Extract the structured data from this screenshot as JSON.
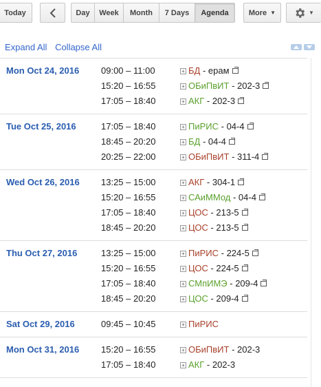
{
  "toolbar": {
    "today_label": "Today",
    "prev_icon": "chevron-left-icon",
    "views": [
      {
        "label": "Day",
        "active": false
      },
      {
        "label": "Week",
        "active": false
      },
      {
        "label": "Month",
        "active": false
      },
      {
        "label": "7 Days",
        "active": false
      },
      {
        "label": "Agenda",
        "active": true
      }
    ],
    "more_label": "More",
    "settings_icon": "gear-icon"
  },
  "controls": {
    "expand_all": "Expand All",
    "collapse_all": "Collapse All"
  },
  "colors": {
    "link": "#3366cc",
    "date": "#2a5db0",
    "red_event": "#a8402a",
    "green_event": "#5aa02c"
  },
  "agenda": [
    {
      "date": "Mon Oct 24, 2016",
      "events": [
        {
          "time": "09:00 – 11:00",
          "name": "БД",
          "rest": " - ерам",
          "color": "#a8402a"
        },
        {
          "time": "15:20 – 16:55",
          "name": "ОБиПвИТ",
          "rest": " - 202-3",
          "color": "#5aa02c"
        },
        {
          "time": "17:05 – 18:40",
          "name": "АКГ",
          "rest": " - 202-3",
          "color": "#5aa02c"
        }
      ]
    },
    {
      "date": "Tue Oct 25, 2016",
      "events": [
        {
          "time": "17:05 – 18:40",
          "name": "ПиРИС",
          "rest": " - 04-4",
          "color": "#5aa02c"
        },
        {
          "time": "18:45 – 20:20",
          "name": "БД",
          "rest": " - 04-4",
          "color": "#5aa02c"
        },
        {
          "time": "20:25 – 22:00",
          "name": "ОБиПвИТ",
          "rest": " - 311-4",
          "color": "#a8402a"
        }
      ]
    },
    {
      "date": "Wed Oct 26, 2016",
      "events": [
        {
          "time": "13:25 – 15:00",
          "name": "АКГ",
          "rest": " - 304-1",
          "color": "#a8402a"
        },
        {
          "time": "15:20 – 16:55",
          "name": "САиММод",
          "rest": " - 04-4",
          "color": "#5aa02c"
        },
        {
          "time": "17:05 – 18:40",
          "name": "ЦОС",
          "rest": " - 213-5",
          "color": "#a8402a"
        },
        {
          "time": "18:45 – 20:20",
          "name": "ЦОС",
          "rest": " - 213-5",
          "color": "#a8402a"
        }
      ]
    },
    {
      "date": "Thu Oct 27, 2016",
      "events": [
        {
          "time": "13:25 – 15:00",
          "name": "ПиРИС",
          "rest": " - 224-5",
          "color": "#a8402a"
        },
        {
          "time": "15:20 – 16:55",
          "name": "ЦОС",
          "rest": " - 224-5",
          "color": "#a8402a"
        },
        {
          "time": "17:05 – 18:40",
          "name": "СМпИМЭ",
          "rest": " - 209-4",
          "color": "#5aa02c"
        },
        {
          "time": "18:45 – 20:20",
          "name": "ЦОС",
          "rest": " - 209-4",
          "color": "#5aa02c"
        }
      ]
    },
    {
      "date": "Sat Oct 29, 2016",
      "events": [
        {
          "time": "09:45 – 10:45",
          "name": "ПиРИС",
          "rest": "",
          "color": "#a8402a",
          "noext": true
        }
      ]
    },
    {
      "date": "Mon Oct 31, 2016",
      "events": [
        {
          "time": "15:20 – 16:55",
          "name": "ОБиПвИТ",
          "rest": " - 202-3",
          "color": "#a8402a",
          "noext": true
        },
        {
          "time": "17:05 – 18:40",
          "name": "АКГ",
          "rest": " - 202-3",
          "color": "#5aa02c",
          "noext": true
        }
      ]
    }
  ]
}
